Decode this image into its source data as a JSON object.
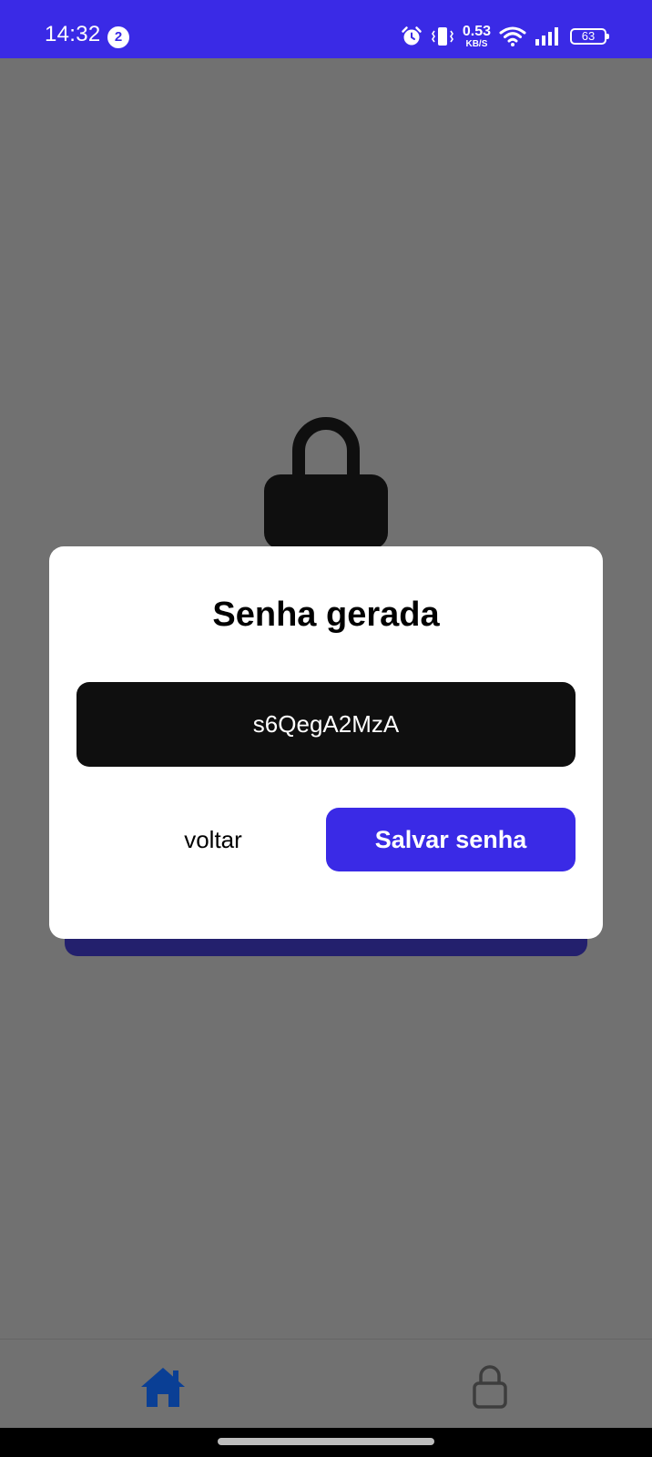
{
  "status_bar": {
    "time": "14:32",
    "notification_count": "2",
    "network_speed": "0.53",
    "network_speed_unit": "KB/S",
    "battery_level": "63",
    "color": "#3a2ae6"
  },
  "modal": {
    "title": "Senha gerada",
    "password": "s6QegA2MzA",
    "back_label": "voltar",
    "save_label": "Salvar senha"
  },
  "bottom_nav": {
    "items": [
      {
        "icon": "home-icon",
        "active": true
      },
      {
        "icon": "lock-icon",
        "active": false
      }
    ]
  },
  "colors": {
    "accent": "#3a2ae6",
    "overlay_background": "#717171",
    "password_box": "#0f0f0f",
    "nav_active": "#0a3f95"
  }
}
